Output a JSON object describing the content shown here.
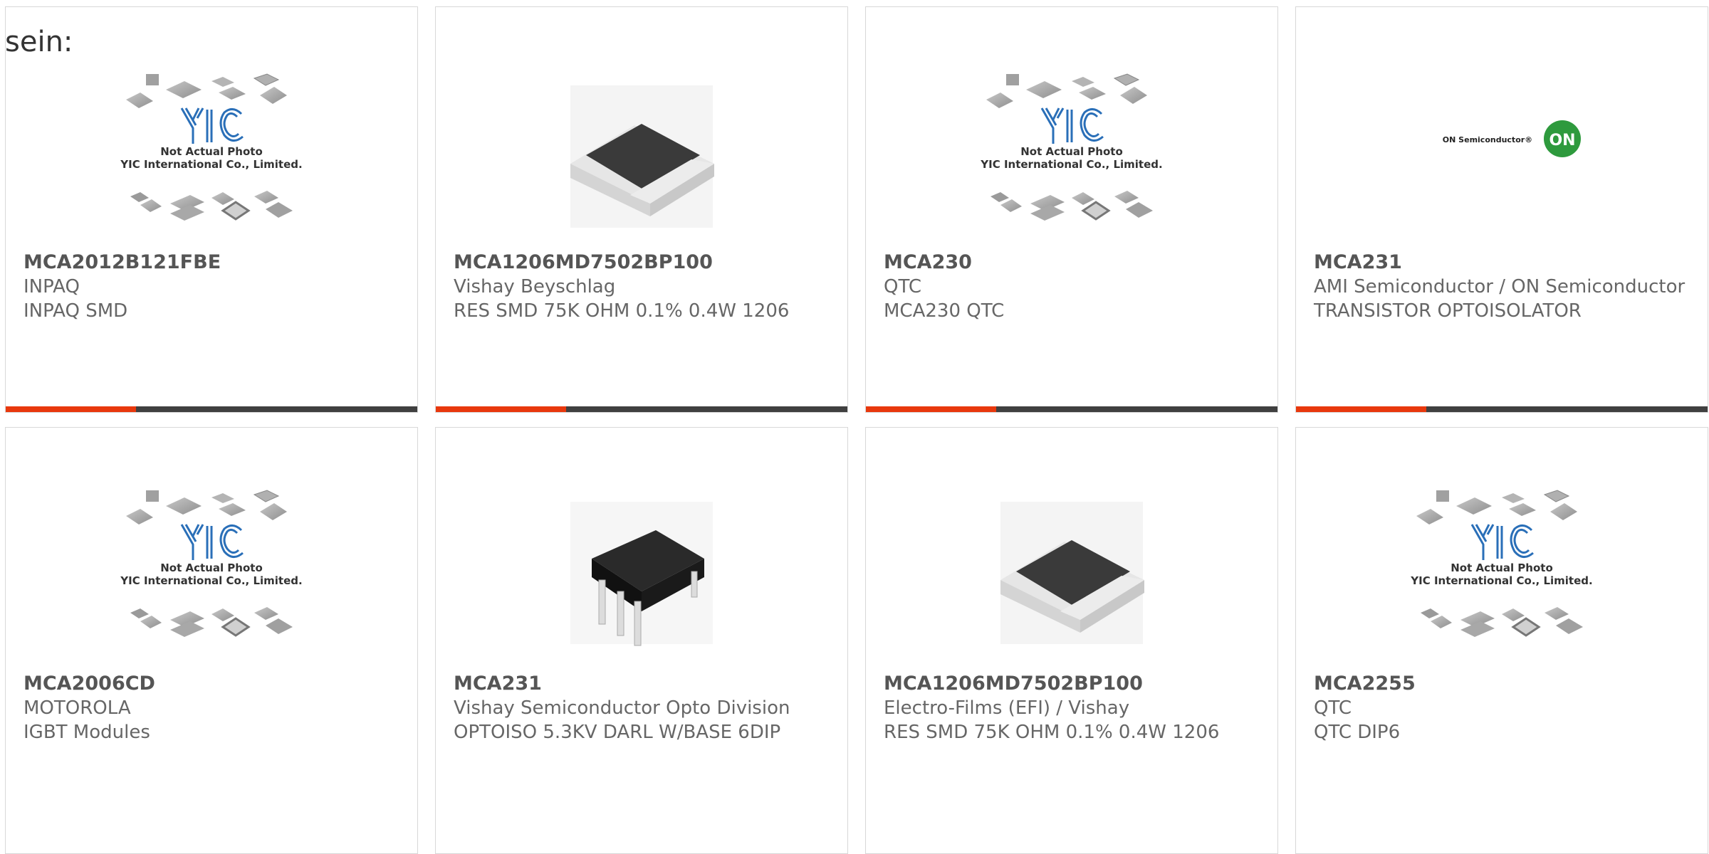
{
  "intro_text": "sein:",
  "accent_color": "#e8380d",
  "bar_color": "#404040",
  "cards": [
    {
      "part": "MCA2012B121FBE",
      "maker": "INPAQ",
      "desc": "INPAQ SMD",
      "image": "yic-placeholder",
      "placeholder_line1": "Not Actual Photo",
      "placeholder_line2": "YIC International Co., Limited."
    },
    {
      "part": "MCA1206MD7502BP100",
      "maker": "Vishay Beyschlag",
      "desc": "RES SMD 75K OHM 0.1% 0.4W 1206",
      "image": "smd-resistor"
    },
    {
      "part": "MCA230",
      "maker": "QTC",
      "desc": "MCA230 QTC",
      "image": "yic-placeholder",
      "placeholder_line1": "Not Actual Photo",
      "placeholder_line2": "YIC International Co., Limited."
    },
    {
      "part": "MCA231",
      "maker": "AMI Semiconductor / ON Semiconductor",
      "desc": "TRANSISTOR OPTOISOLATOR",
      "image": "on-semi-logo",
      "logo_text": "ON Semiconductor®",
      "logo_badge": "ON"
    },
    {
      "part": "MCA2006CD",
      "maker": "MOTOROLA",
      "desc": "IGBT Modules",
      "image": "yic-placeholder",
      "placeholder_line1": "Not Actual Photo",
      "placeholder_line2": "YIC International Co., Limited."
    },
    {
      "part": "MCA231",
      "maker": "Vishay Semiconductor Opto Division",
      "desc": "OPTOISO 5.3KV DARL W/BASE 6DIP",
      "image": "dip6-chip"
    },
    {
      "part": "MCA1206MD7502BP100",
      "maker": "Electro-Films (EFI) / Vishay",
      "desc": "RES SMD 75K OHM 0.1% 0.4W 1206",
      "image": "smd-resistor"
    },
    {
      "part": "MCA2255",
      "maker": "QTC",
      "desc": "QTC DIP6",
      "image": "yic-placeholder",
      "placeholder_line1": "Not Actual Photo",
      "placeholder_line2": "YIC International Co., Limited."
    }
  ]
}
